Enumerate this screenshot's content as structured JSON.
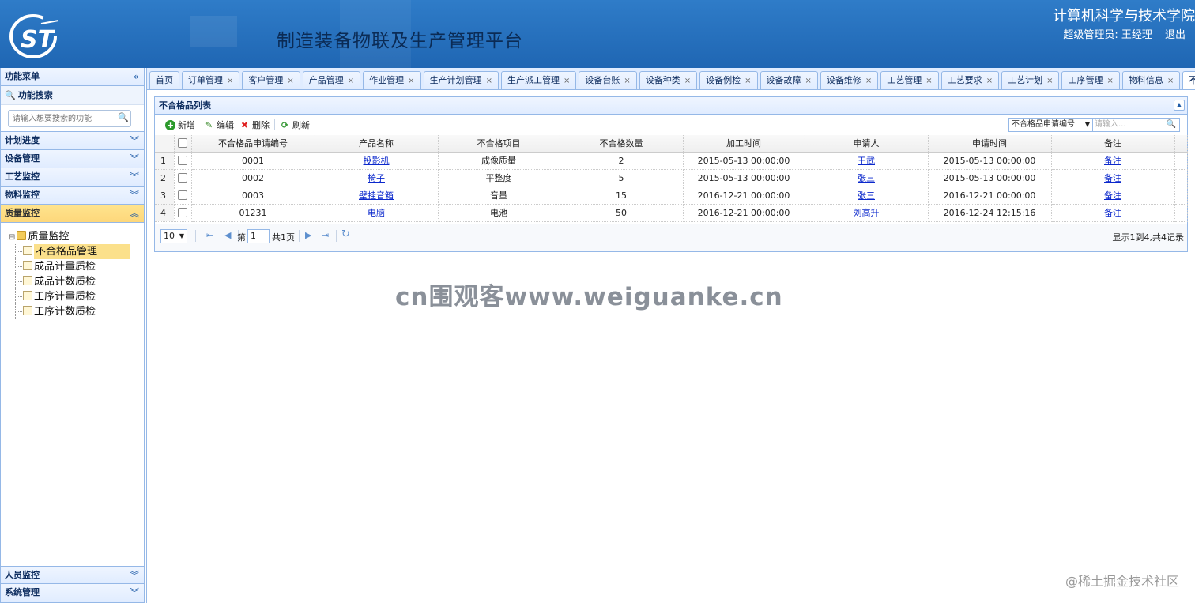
{
  "header": {
    "system_title": "制造装备物联及生产管理平台",
    "college": "计算机科学与技术学院",
    "user_label": "超级管理员: 王经理",
    "logout": "退出",
    "brand_color": "#1f66b3"
  },
  "sidebar": {
    "menu_title": "功能菜单",
    "search_title": "功能搜索",
    "search_placeholder": "请输入想要搜索的功能",
    "panels": [
      "计划进度",
      "设备管理",
      "工艺监控",
      "物料监控"
    ],
    "active_panel": "质量监控",
    "tree": {
      "root": "质量监控",
      "children": [
        "不合格品管理",
        "成品计量质检",
        "成品计数质检",
        "工序计量质检",
        "工序计数质检"
      ]
    },
    "bottom_panels": [
      "人员监控",
      "系统管理"
    ]
  },
  "tabs": [
    {
      "label": "首页",
      "closable": false
    },
    {
      "label": "订单管理",
      "closable": true
    },
    {
      "label": "客户管理",
      "closable": true
    },
    {
      "label": "产品管理",
      "closable": true
    },
    {
      "label": "作业管理",
      "closable": true
    },
    {
      "label": "生产计划管理",
      "closable": true
    },
    {
      "label": "生产派工管理",
      "closable": true
    },
    {
      "label": "设备台账",
      "closable": true
    },
    {
      "label": "设备种类",
      "closable": true
    },
    {
      "label": "设备例检",
      "closable": true
    },
    {
      "label": "设备故障",
      "closable": true
    },
    {
      "label": "设备维修",
      "closable": true
    },
    {
      "label": "工艺管理",
      "closable": true
    },
    {
      "label": "工艺要求",
      "closable": true
    },
    {
      "label": "工艺计划",
      "closable": true
    },
    {
      "label": "工序管理",
      "closable": true
    },
    {
      "label": "物料信息",
      "closable": true
    },
    {
      "label": "不合格品管理",
      "closable": true,
      "active": true
    }
  ],
  "grid": {
    "title": "不合格品列表",
    "toolbar": {
      "add": "新增",
      "edit": "编辑",
      "delete": "删除",
      "refresh": "刷新"
    },
    "search_field": "不合格品申请编号",
    "search_placeholder": "请输入...",
    "columns": [
      "不合格品申请编号",
      "产品名称",
      "不合格项目",
      "不合格数量",
      "加工时间",
      "申请人",
      "申请时间",
      "备注"
    ],
    "rows": [
      [
        "0001",
        "投影机",
        "成像质量",
        "2",
        "2015-05-13 00:00:00",
        "王武",
        "2015-05-13 00:00:00",
        "备注"
      ],
      [
        "0002",
        "椅子",
        "平整度",
        "5",
        "2015-05-13 00:00:00",
        "张三",
        "2015-05-13 00:00:00",
        "备注"
      ],
      [
        "0003",
        "壁挂音箱",
        "音量",
        "15",
        "2016-12-21 00:00:00",
        "张三",
        "2016-12-21 00:00:00",
        "备注"
      ],
      [
        "01231",
        "电脑",
        "电池",
        "50",
        "2016-12-21 00:00:00",
        "刘高升",
        "2016-12-24 12:15:16",
        "备注"
      ]
    ],
    "pager": {
      "page_size": "10",
      "page_prefix": "第",
      "page_value": "1",
      "page_total": "共1页",
      "info": "显示1到4,共4记录"
    }
  },
  "watermark": "cn围观客www.weiguanke.cn",
  "watermark2": "@稀土掘金技术社区"
}
